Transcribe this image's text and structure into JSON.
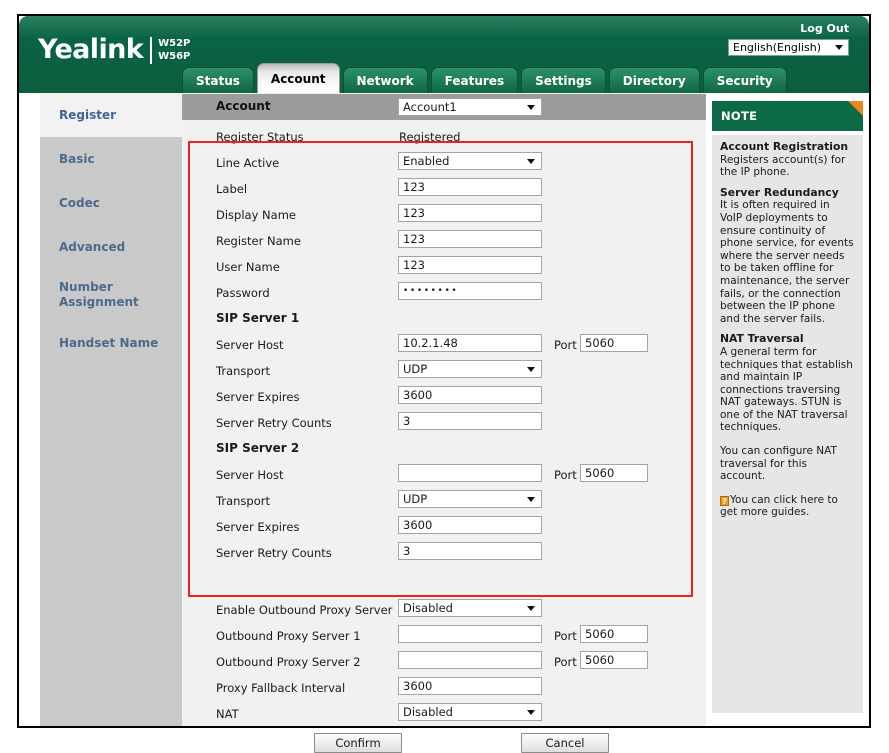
{
  "header": {
    "logo_word": "Yealink",
    "logo_models": [
      "W52P",
      "W56P"
    ],
    "logout_label": "Log Out",
    "language": "English(English)"
  },
  "tabs": [
    {
      "label": "Status",
      "active": false
    },
    {
      "label": "Account",
      "active": true
    },
    {
      "label": "Network",
      "active": false
    },
    {
      "label": "Features",
      "active": false
    },
    {
      "label": "Settings",
      "active": false
    },
    {
      "label": "Directory",
      "active": false
    },
    {
      "label": "Security",
      "active": false
    }
  ],
  "sidebar": {
    "items": [
      {
        "label": "Register",
        "active": true
      },
      {
        "label": "Basic",
        "active": false
      },
      {
        "label": "Codec",
        "active": false
      },
      {
        "label": "Advanced",
        "active": false
      },
      {
        "label": "Number Assignment",
        "line1": "Number",
        "line2": "Assignment",
        "active": false
      },
      {
        "label": "Handset Name",
        "active": false
      }
    ]
  },
  "form": {
    "account_band_label": "Account",
    "account_value": "Account1",
    "register_status_label": "Register Status",
    "register_status_value": "Registered",
    "line_active_label": "Line Active",
    "line_active_value": "Enabled",
    "label_label": "Label",
    "label_value": "123",
    "display_name_label": "Display Name",
    "display_name_value": "123",
    "register_name_label": "Register Name",
    "register_name_value": "123",
    "user_name_label": "User Name",
    "user_name_value": "123",
    "password_label": "Password",
    "password_value": "••••••••",
    "sip_server_1_heading": "SIP Server 1",
    "sip1_server_host_label": "Server Host",
    "sip1_server_host_value": "10.2.1.48",
    "sip1_port_label": "Port",
    "sip1_port_value": "5060",
    "sip1_transport_label": "Transport",
    "sip1_transport_value": "UDP",
    "sip1_expires_label": "Server Expires",
    "sip1_expires_value": "3600",
    "sip1_retry_label": "Server Retry Counts",
    "sip1_retry_value": "3",
    "sip_server_2_heading": "SIP Server 2",
    "sip2_server_host_label": "Server Host",
    "sip2_server_host_value": "",
    "sip2_port_label": "Port",
    "sip2_port_value": "5060",
    "sip2_transport_label": "Transport",
    "sip2_transport_value": "UDP",
    "sip2_expires_label": "Server Expires",
    "sip2_expires_value": "3600",
    "sip2_retry_label": "Server Retry Counts",
    "sip2_retry_value": "3",
    "enable_outbound_label": "Enable Outbound Proxy Server",
    "enable_outbound_value": "Disabled",
    "outbound1_label": "Outbound Proxy Server 1",
    "outbound1_value": "",
    "outbound1_port_label": "Port",
    "outbound1_port_value": "5060",
    "outbound2_label": "Outbound Proxy Server 2",
    "outbound2_value": "",
    "outbound2_port_label": "Port",
    "outbound2_port_value": "5060",
    "fallback_label": "Proxy Fallback Interval",
    "fallback_value": "3600",
    "nat_label": "NAT",
    "nat_value": "Disabled",
    "confirm_label": "Confirm",
    "cancel_label": "Cancel",
    "highlight_color": "#ee2222"
  },
  "note": {
    "title": "NOTE",
    "sections": [
      {
        "heading": "Account Registration",
        "text": "Registers account(s) for the IP phone."
      },
      {
        "heading": "Server Redundancy",
        "text": "It is often required in VoIP deployments to ensure continuity of phone service, for events where the server needs to be taken offline for maintenance, the server fails, or the connection between the IP phone and the server fails."
      },
      {
        "heading": "NAT Traversal",
        "text": "A general term for techniques that establish and maintain IP connections traversing NAT gateways. STUN is one of the NAT traversal techniques."
      }
    ],
    "extra_text": "You can configure NAT traversal for this account.",
    "link_text": "You can click here to get more guides.",
    "link_icon": "question-mark-icon"
  }
}
